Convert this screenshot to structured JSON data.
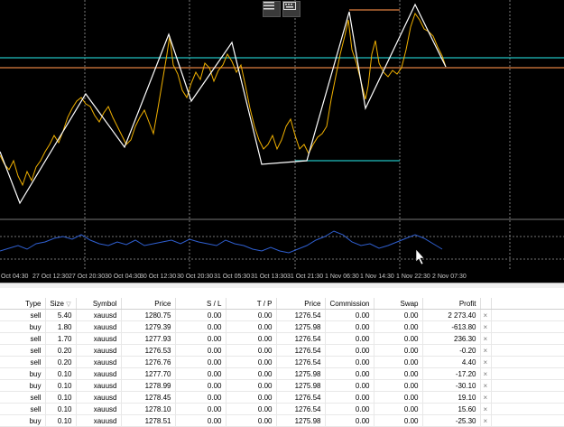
{
  "chart": {
    "colors": {
      "price_line": "#f0b000",
      "zigzag": "#ffffff",
      "indicator": "#2f5fd0",
      "level_line": "#20c0c0",
      "level_line2": "#e08040",
      "grid": "#9a9a9a"
    },
    "time_labels": [
      "Oct 04:30",
      "27 Oct 12:30",
      "27 Oct 20:30",
      "30 Oct 04:30",
      "30 Oct 12:30",
      "30 Oct 20:30",
      "31 Oct 05:30",
      "31 Oct 13:30",
      "31 Oct 21:30",
      "1 Nov 06:30",
      "1 Nov 14:30",
      "1 Nov 22:30",
      "2 Nov 07:30"
    ],
    "toolbar": {
      "menu_icon": "menu-icon",
      "keyboard_icon": "keyboard-icon"
    }
  },
  "trades": {
    "columns": [
      "Type",
      "Size",
      "Symbol",
      "Price",
      "S / L",
      "T / P",
      "Price",
      "Commission",
      "Swap",
      "Profit",
      ""
    ],
    "sort_indicator": "▽",
    "rows": [
      {
        "type": "sell",
        "size": "5.40",
        "symbol": "xauusd",
        "open_price": "1280.75",
        "sl": "0.00",
        "tp": "0.00",
        "price": "1276.54",
        "commission": "0.00",
        "swap": "0.00",
        "profit": "2 273.40"
      },
      {
        "type": "buy",
        "size": "1.80",
        "symbol": "xauusd",
        "open_price": "1279.39",
        "sl": "0.00",
        "tp": "0.00",
        "price": "1275.98",
        "commission": "0.00",
        "swap": "0.00",
        "profit": "-613.80"
      },
      {
        "type": "sell",
        "size": "1.70",
        "symbol": "xauusd",
        "open_price": "1277.93",
        "sl": "0.00",
        "tp": "0.00",
        "price": "1276.54",
        "commission": "0.00",
        "swap": "0.00",
        "profit": "236.30"
      },
      {
        "type": "sell",
        "size": "0.20",
        "symbol": "xauusd",
        "open_price": "1276.53",
        "sl": "0.00",
        "tp": "0.00",
        "price": "1276.54",
        "commission": "0.00",
        "swap": "0.00",
        "profit": "-0.20"
      },
      {
        "type": "sell",
        "size": "0.20",
        "symbol": "xauusd",
        "open_price": "1276.76",
        "sl": "0.00",
        "tp": "0.00",
        "price": "1276.54",
        "commission": "0.00",
        "swap": "0.00",
        "profit": "4.40"
      },
      {
        "type": "buy",
        "size": "0.10",
        "symbol": "xauusd",
        "open_price": "1277.70",
        "sl": "0.00",
        "tp": "0.00",
        "price": "1275.98",
        "commission": "0.00",
        "swap": "0.00",
        "profit": "-17.20"
      },
      {
        "type": "buy",
        "size": "0.10",
        "symbol": "xauusd",
        "open_price": "1278.99",
        "sl": "0.00",
        "tp": "0.00",
        "price": "1275.98",
        "commission": "0.00",
        "swap": "0.00",
        "profit": "-30.10"
      },
      {
        "type": "sell",
        "size": "0.10",
        "symbol": "xauusd",
        "open_price": "1278.45",
        "sl": "0.00",
        "tp": "0.00",
        "price": "1276.54",
        "commission": "0.00",
        "swap": "0.00",
        "profit": "19.10"
      },
      {
        "type": "sell",
        "size": "0.10",
        "symbol": "xauusd",
        "open_price": "1278.10",
        "sl": "0.00",
        "tp": "0.00",
        "price": "1276.54",
        "commission": "0.00",
        "swap": "0.00",
        "profit": "15.60"
      },
      {
        "type": "buy",
        "size": "0.10",
        "symbol": "xauusd",
        "open_price": "1278.51",
        "sl": "0.00",
        "tp": "0.00",
        "price": "1275.98",
        "commission": "0.00",
        "swap": "0.00",
        "profit": "-25.30"
      }
    ],
    "close_glyph": "×"
  }
}
